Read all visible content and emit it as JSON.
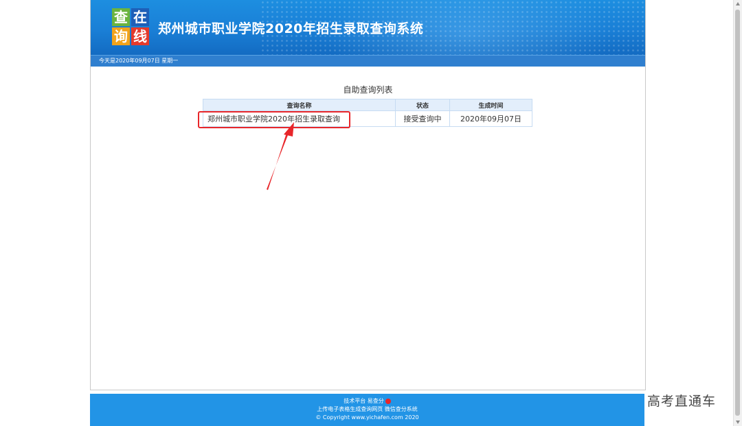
{
  "header": {
    "logo_chars": [
      "查",
      "在",
      "询",
      "线"
    ],
    "title": "郑州城市职业学院2020年招生录取查询系统",
    "date_text": "今天是2020年09月07日  星期一"
  },
  "main": {
    "list_title": "自助查询列表",
    "columns": [
      "查询名称",
      "状态",
      "生成时间"
    ],
    "rows": [
      {
        "name": "郑州城市职业学院2020年招生录取查询",
        "status": "接受查询中",
        "time": "2020年09月07日"
      }
    ]
  },
  "footer": {
    "line1": "技术平台 易查分",
    "line2": "上传电子表格生成查询网页 微信查分系统",
    "line3": "© Copyright www.yichafen.com 2020"
  },
  "watermark": "高考直通车",
  "colors": {
    "banner": "#1a7fd6",
    "highlight": "#e8262a",
    "footer": "#2294e6"
  }
}
